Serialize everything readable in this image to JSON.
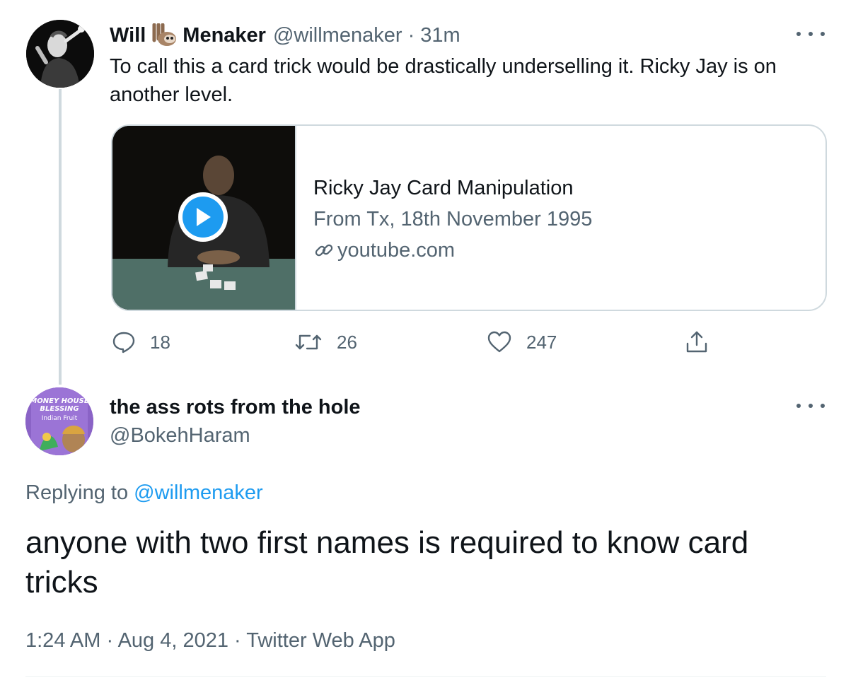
{
  "tweet": {
    "author_first": "Will",
    "author_emoji": "sloth-emoji",
    "author_last": "Menaker",
    "handle": "@willmenaker",
    "separator": " · ",
    "time": "31m",
    "text": "To call this a card trick would be drastically underselling it. Ricky Jay is on another level.",
    "card": {
      "title": "Ricky Jay Card Manipulation",
      "description": "From Tx, 18th November 1995",
      "domain": "youtube.com"
    },
    "actions": {
      "replies": "18",
      "retweets": "26",
      "likes": "247"
    }
  },
  "reply": {
    "author": "the ass rots from the hole",
    "handle": "@BokehHaram",
    "replying_prefix": "Replying to ",
    "replying_to": "@willmenaker",
    "text": "anyone with two first names is required to know card tricks",
    "timestamp": "1:24 AM",
    "date": "Aug 4, 2021",
    "source": "Twitter Web App",
    "dot": " · ",
    "avatar_text": [
      "MONEY HOUSE",
      "BLESSING",
      "Indian Fruit"
    ]
  },
  "colors": {
    "accent": "#1d9bf0",
    "secondary_text": "#536471",
    "border": "#cfd9de"
  }
}
